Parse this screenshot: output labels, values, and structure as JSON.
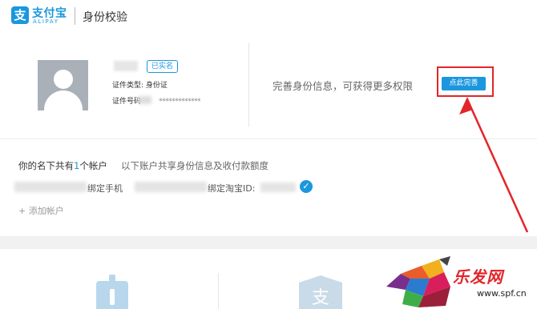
{
  "header": {
    "logo_char": "支",
    "logo_cn": "支付宝",
    "logo_en": "ALIPAY",
    "title": "身份校验"
  },
  "profile": {
    "badge": "已实名",
    "id_type": "证件类型: 身份证",
    "id_no_label": "证件号码",
    "id_no_mask": "*************",
    "promo": "完善身份信息，可获得更多权限",
    "improve_button": "点此完善"
  },
  "accounts": {
    "title_prefix": "你的名下共有",
    "count": "1",
    "title_suffix": "个帐户",
    "note": "以下账户共享身份信息及收付款额度",
    "phone_label": "绑定手机",
    "taobao_label": "绑定淘宝ID:",
    "add_link": "+ 添加帐户"
  },
  "watermark": {
    "brand": "乐发网",
    "url": "www.spf.cn"
  },
  "colors": {
    "accent": "#1a97de",
    "highlight": "#e3252a"
  }
}
